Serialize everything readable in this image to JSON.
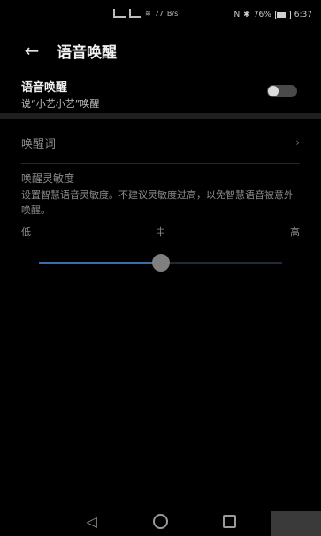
{
  "status_bar": {
    "speed_value": "77",
    "speed_unit": "B/s",
    "battery_percent": "76%",
    "time": "6:37"
  },
  "header": {
    "title": "语音唤醒"
  },
  "voice_wakeup": {
    "label": "语音唤醒",
    "subtitle": "说“小艺小艺”唤醒",
    "enabled": false
  },
  "wake_word": {
    "label": "唤醒词"
  },
  "sensitivity": {
    "title": "唤醒灵敏度",
    "description": "设置智慧语音灵敏度。不建议灵敏度过高，以免智慧语音被意外唤醒。",
    "low_label": "低",
    "mid_label": "中",
    "high_label": "高",
    "value": 0.5
  },
  "icons": {
    "back": "arrow-left-icon",
    "chevron": "chevron-right-icon",
    "nav_back": "triangle-back-icon",
    "nav_home": "circle-home-icon",
    "nav_recent": "square-recent-icon"
  }
}
